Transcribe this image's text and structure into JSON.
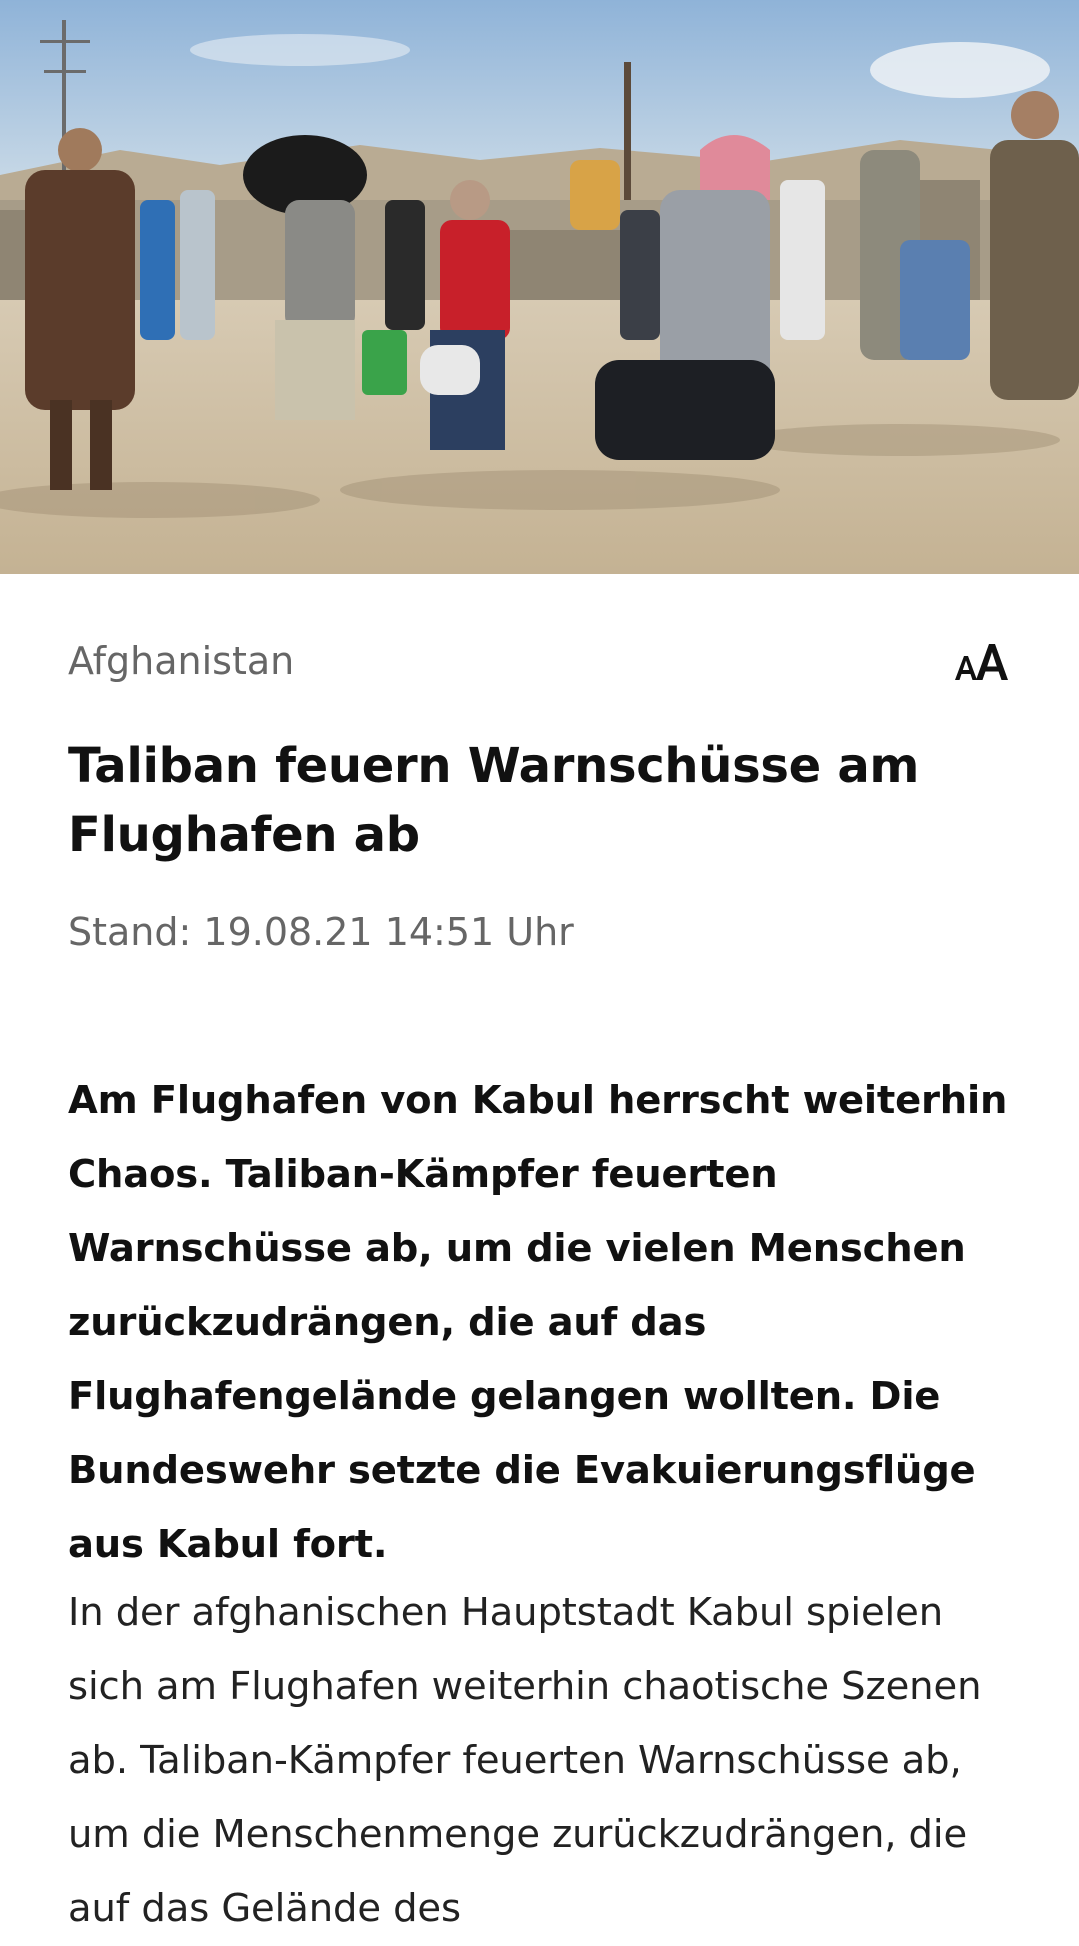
{
  "hero_image": {
    "alt": "Menschen mit Gepäck am Flughafen Kabul"
  },
  "article": {
    "topline": "Afghanistan",
    "font_size_button_label": "AA",
    "headline": "Taliban feuern Warnschüsse am Flughafen ab",
    "dateline": "Stand: 19.08.21 14:51 Uhr",
    "teaser": "Am Flughafen von Kabul herrscht weiterhin Chaos. Taliban-Kämpfer feuerten Warnschüsse ab, um die vielen Menschen zurückzudrängen, die auf das Flughafengelände gelangen wollten. Die Bundeswehr setzte die Evakuierungsflüge aus Kabul fort.",
    "body": "In der afghanischen Hauptstadt Kabul spielen sich am Flughafen weiterhin chaotische Szenen ab. Taliban-Kämpfer feuerten Warnschüsse ab, um die Menschenmenge zurückzudrängen, die auf das Gelände des"
  },
  "icons": {
    "font_size": "font-size-icon"
  },
  "colors": {
    "topline": "#666666",
    "headline": "#111111",
    "background": "#ffffff"
  }
}
